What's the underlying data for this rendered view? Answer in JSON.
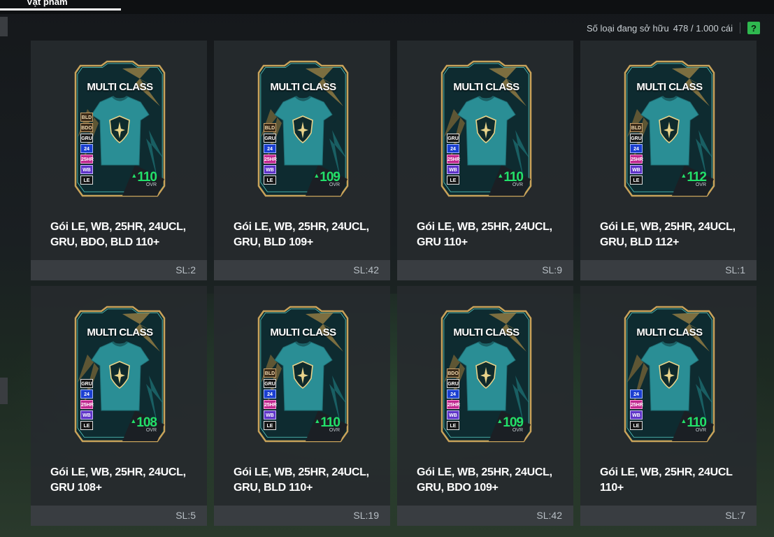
{
  "header": {
    "tab_label": "Vật phẩm"
  },
  "owned": {
    "label": "Số loại đang sở hữu",
    "count": "478 / 1.000 cái",
    "help_label": "?"
  },
  "colors": {
    "accent_green": "#2fb84f",
    "ovr_green": "#22e06a",
    "card_teal": "#2a8e95"
  },
  "items": [
    {
      "card_label": "MULTI CLASS",
      "badges": [
        "BLD",
        "BDO",
        "GRU",
        "24",
        "25HR",
        "WB",
        "LE"
      ],
      "ovr": "110",
      "ovr_label": "OVR",
      "title": "Gói LE, WB, 25HR, 24UCL, GRU, BDO, BLD 110+",
      "qty": "SL:2"
    },
    {
      "card_label": "MULTI CLASS",
      "badges": [
        "BLD",
        "GRU",
        "24",
        "25HR",
        "WB",
        "LE"
      ],
      "ovr": "109",
      "ovr_label": "OVR",
      "title": "Gói LE, WB, 25HR, 24UCL, GRU, BLD 109+",
      "qty": "SL:42"
    },
    {
      "card_label": "MULTI CLASS",
      "badges": [
        "GRU",
        "24",
        "25HR",
        "WB",
        "LE"
      ],
      "ovr": "110",
      "ovr_label": "OVR",
      "title": "Gói LE, WB, 25HR, 24UCL, GRU 110+",
      "qty": "SL:9"
    },
    {
      "card_label": "MULTI CLASS",
      "badges": [
        "BLD",
        "GRU",
        "24",
        "25HR",
        "WB",
        "LE"
      ],
      "ovr": "112",
      "ovr_label": "OVR",
      "title": "Gói LE, WB, 25HR, 24UCL, GRU, BLD 112+",
      "qty": "SL:1"
    },
    {
      "card_label": "MULTI CLASS",
      "badges": [
        "GRU",
        "24",
        "25HR",
        "WB",
        "LE"
      ],
      "ovr": "108",
      "ovr_label": "OVR",
      "title": "Gói LE, WB, 25HR, 24UCL, GRU 108+",
      "qty": "SL:5"
    },
    {
      "card_label": "MULTI CLASS",
      "badges": [
        "BLD",
        "GRU",
        "24",
        "25HR",
        "WB",
        "LE"
      ],
      "ovr": "110",
      "ovr_label": "OVR",
      "title": "Gói LE, WB, 25HR, 24UCL, GRU, BLD 110+",
      "qty": "SL:19"
    },
    {
      "card_label": "MULTI CLASS",
      "badges": [
        "BDO",
        "GRU",
        "24",
        "25HR",
        "WB",
        "LE"
      ],
      "ovr": "109",
      "ovr_label": "OVR",
      "title": "Gói LE, WB, 25HR, 24UCL, GRU, BDO 109+",
      "qty": "SL:42"
    },
    {
      "card_label": "MULTI CLASS",
      "badges": [
        "24",
        "25HR",
        "WB",
        "LE"
      ],
      "ovr": "110",
      "ovr_label": "OVR",
      "title": "Gói LE, WB, 25HR, 24UCL 110+",
      "qty": "SL:7"
    }
  ]
}
